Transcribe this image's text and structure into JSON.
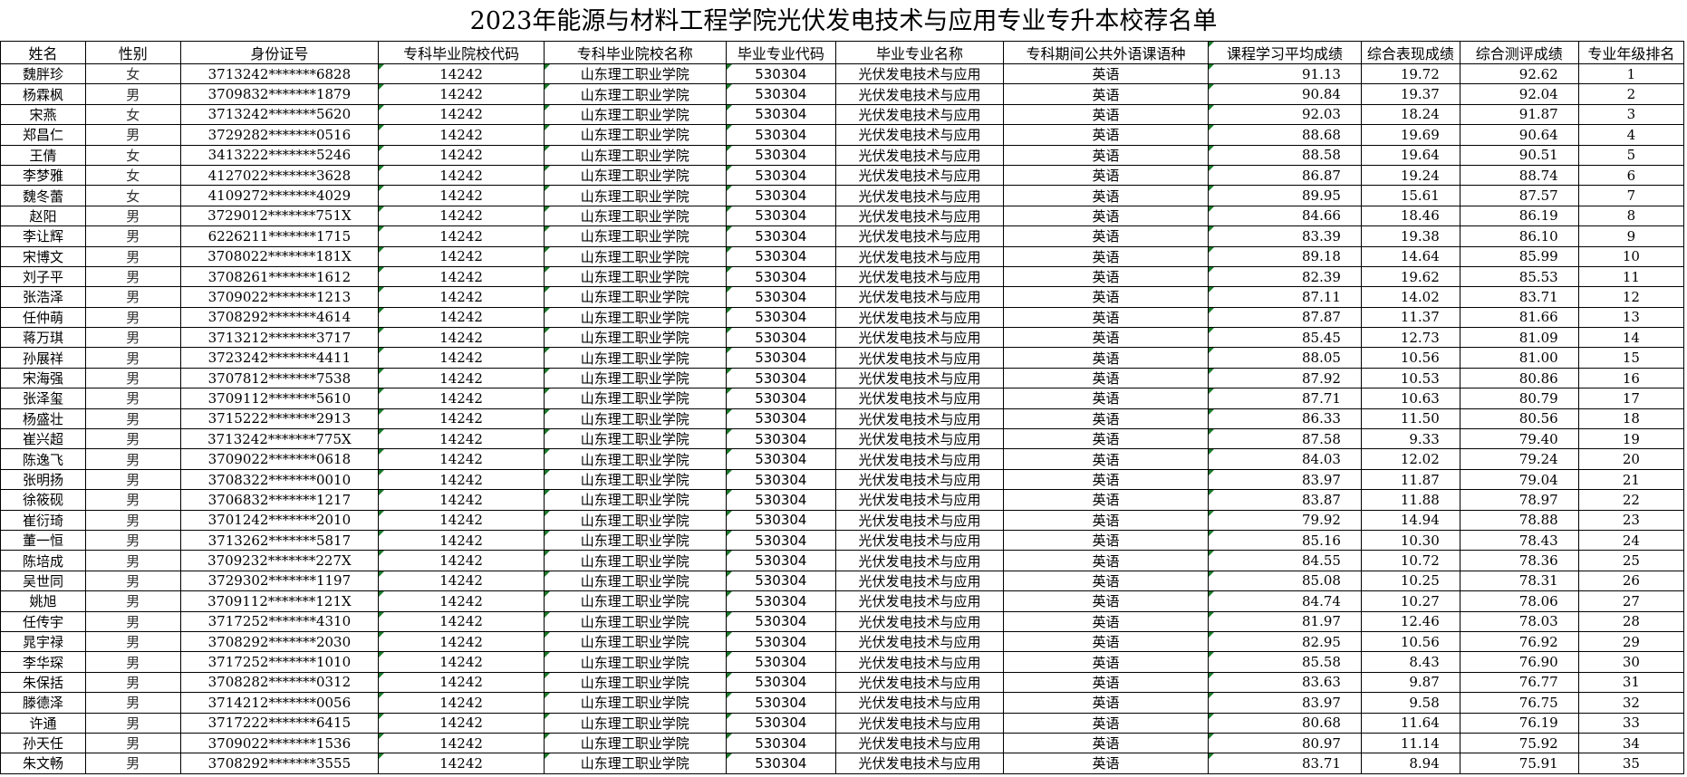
{
  "title": "2023年能源与材料工程学院光伏发电技术与应用专业专升本校荐名单",
  "columns": [
    "姓名",
    "性别",
    "身份证号",
    "专科毕业院校代码",
    "专科毕业院校名称",
    "毕业专业代码",
    "毕业专业名称",
    "专科期间公共外语课语种",
    "课程学习平均成绩",
    "综合表现成绩",
    "综合测评成绩",
    "专业年级排名"
  ],
  "rows": [
    {
      "name": "魏胖珍",
      "gender": "女",
      "id": "3713242*******6828",
      "school_code": "14242",
      "school_name": "山东理工职业学院",
      "major_code": "530304",
      "major_name": "光伏发电技术与应用",
      "language": "英语",
      "avg": "91.13",
      "perf": "19.72",
      "total": "92.62",
      "rank": "1"
    },
    {
      "name": "杨霖枫",
      "gender": "男",
      "id": "3709832*******1879",
      "school_code": "14242",
      "school_name": "山东理工职业学院",
      "major_code": "530304",
      "major_name": "光伏发电技术与应用",
      "language": "英语",
      "avg": "90.84",
      "perf": "19.37",
      "total": "92.04",
      "rank": "2"
    },
    {
      "name": "宋燕",
      "gender": "女",
      "id": "3713242*******5620",
      "school_code": "14242",
      "school_name": "山东理工职业学院",
      "major_code": "530304",
      "major_name": "光伏发电技术与应用",
      "language": "英语",
      "avg": "92.03",
      "perf": "18.24",
      "total": "91.87",
      "rank": "3"
    },
    {
      "name": "郑昌仁",
      "gender": "男",
      "id": "3729282*******0516",
      "school_code": "14242",
      "school_name": "山东理工职业学院",
      "major_code": "530304",
      "major_name": "光伏发电技术与应用",
      "language": "英语",
      "avg": "88.68",
      "perf": "19.69",
      "total": "90.64",
      "rank": "4"
    },
    {
      "name": "王倩",
      "gender": "女",
      "id": "3413222*******5246",
      "school_code": "14242",
      "school_name": "山东理工职业学院",
      "major_code": "530304",
      "major_name": "光伏发电技术与应用",
      "language": "英语",
      "avg": "88.58",
      "perf": "19.64",
      "total": "90.51",
      "rank": "5"
    },
    {
      "name": "李梦雅",
      "gender": "女",
      "id": "4127022*******3628",
      "school_code": "14242",
      "school_name": "山东理工职业学院",
      "major_code": "530304",
      "major_name": "光伏发电技术与应用",
      "language": "英语",
      "avg": "86.87",
      "perf": "19.24",
      "total": "88.74",
      "rank": "6"
    },
    {
      "name": "魏冬蕾",
      "gender": "女",
      "id": "4109272*******4029",
      "school_code": "14242",
      "school_name": "山东理工职业学院",
      "major_code": "530304",
      "major_name": "光伏发电技术与应用",
      "language": "英语",
      "avg": "89.95",
      "perf": "15.61",
      "total": "87.57",
      "rank": "7"
    },
    {
      "name": "赵阳",
      "gender": "男",
      "id": "3729012*******751X",
      "school_code": "14242",
      "school_name": "山东理工职业学院",
      "major_code": "530304",
      "major_name": "光伏发电技术与应用",
      "language": "英语",
      "avg": "84.66",
      "perf": "18.46",
      "total": "86.19",
      "rank": "8"
    },
    {
      "name": "李让辉",
      "gender": "男",
      "id": "6226211*******1715",
      "school_code": "14242",
      "school_name": "山东理工职业学院",
      "major_code": "530304",
      "major_name": "光伏发电技术与应用",
      "language": "英语",
      "avg": "83.39",
      "perf": "19.38",
      "total": "86.10",
      "rank": "9"
    },
    {
      "name": "宋博文",
      "gender": "男",
      "id": "3708022*******181X",
      "school_code": "14242",
      "school_name": "山东理工职业学院",
      "major_code": "530304",
      "major_name": "光伏发电技术与应用",
      "language": "英语",
      "avg": "89.18",
      "perf": "14.64",
      "total": "85.99",
      "rank": "10"
    },
    {
      "name": "刘子平",
      "gender": "男",
      "id": "3708261*******1612",
      "school_code": "14242",
      "school_name": "山东理工职业学院",
      "major_code": "530304",
      "major_name": "光伏发电技术与应用",
      "language": "英语",
      "avg": "82.39",
      "perf": "19.62",
      "total": "85.53",
      "rank": "11"
    },
    {
      "name": "张浩泽",
      "gender": "男",
      "id": "3709022*******1213",
      "school_code": "14242",
      "school_name": "山东理工职业学院",
      "major_code": "530304",
      "major_name": "光伏发电技术与应用",
      "language": "英语",
      "avg": "87.11",
      "perf": "14.02",
      "total": "83.71",
      "rank": "12"
    },
    {
      "name": "任仲萌",
      "gender": "男",
      "id": "3708292*******4614",
      "school_code": "14242",
      "school_name": "山东理工职业学院",
      "major_code": "530304",
      "major_name": "光伏发电技术与应用",
      "language": "英语",
      "avg": "87.87",
      "perf": "11.37",
      "total": "81.66",
      "rank": "13"
    },
    {
      "name": "蒋万琪",
      "gender": "男",
      "id": "3713212*******3717",
      "school_code": "14242",
      "school_name": "山东理工职业学院",
      "major_code": "530304",
      "major_name": "光伏发电技术与应用",
      "language": "英语",
      "avg": "85.45",
      "perf": "12.73",
      "total": "81.09",
      "rank": "14"
    },
    {
      "name": "孙展祥",
      "gender": "男",
      "id": "3723242*******4411",
      "school_code": "14242",
      "school_name": "山东理工职业学院",
      "major_code": "530304",
      "major_name": "光伏发电技术与应用",
      "language": "英语",
      "avg": "88.05",
      "perf": "10.56",
      "total": "81.00",
      "rank": "15"
    },
    {
      "name": "宋海强",
      "gender": "男",
      "id": "3707812*******7538",
      "school_code": "14242",
      "school_name": "山东理工职业学院",
      "major_code": "530304",
      "major_name": "光伏发电技术与应用",
      "language": "英语",
      "avg": "87.92",
      "perf": "10.53",
      "total": "80.86",
      "rank": "16"
    },
    {
      "name": "张泽玺",
      "gender": "男",
      "id": "3709112*******5610",
      "school_code": "14242",
      "school_name": "山东理工职业学院",
      "major_code": "530304",
      "major_name": "光伏发电技术与应用",
      "language": "英语",
      "avg": "87.71",
      "perf": "10.63",
      "total": "80.79",
      "rank": "17"
    },
    {
      "name": "杨盛壮",
      "gender": "男",
      "id": "3715222*******2913",
      "school_code": "14242",
      "school_name": "山东理工职业学院",
      "major_code": "530304",
      "major_name": "光伏发电技术与应用",
      "language": "英语",
      "avg": "86.33",
      "perf": "11.50",
      "total": "80.56",
      "rank": "18"
    },
    {
      "name": "崔兴超",
      "gender": "男",
      "id": "3713242*******775X",
      "school_code": "14242",
      "school_name": "山东理工职业学院",
      "major_code": "530304",
      "major_name": "光伏发电技术与应用",
      "language": "英语",
      "avg": "87.58",
      "perf": "9.33",
      "total": "79.40",
      "rank": "19"
    },
    {
      "name": "陈逸飞",
      "gender": "男",
      "id": "3709022*******0618",
      "school_code": "14242",
      "school_name": "山东理工职业学院",
      "major_code": "530304",
      "major_name": "光伏发电技术与应用",
      "language": "英语",
      "avg": "84.03",
      "perf": "12.02",
      "total": "79.24",
      "rank": "20"
    },
    {
      "name": "张明扬",
      "gender": "男",
      "id": "3708322*******0010",
      "school_code": "14242",
      "school_name": "山东理工职业学院",
      "major_code": "530304",
      "major_name": "光伏发电技术与应用",
      "language": "英语",
      "avg": "83.97",
      "perf": "11.87",
      "total": "79.04",
      "rank": "21"
    },
    {
      "name": "徐筱砚",
      "gender": "男",
      "id": "3706832*******1217",
      "school_code": "14242",
      "school_name": "山东理工职业学院",
      "major_code": "530304",
      "major_name": "光伏发电技术与应用",
      "language": "英语",
      "avg": "83.87",
      "perf": "11.88",
      "total": "78.97",
      "rank": "22"
    },
    {
      "name": "崔衍琦",
      "gender": "男",
      "id": "3701242*******2010",
      "school_code": "14242",
      "school_name": "山东理工职业学院",
      "major_code": "530304",
      "major_name": "光伏发电技术与应用",
      "language": "英语",
      "avg": "79.92",
      "perf": "14.94",
      "total": "78.88",
      "rank": "23"
    },
    {
      "name": "董一恒",
      "gender": "男",
      "id": "3713262*******5817",
      "school_code": "14242",
      "school_name": "山东理工职业学院",
      "major_code": "530304",
      "major_name": "光伏发电技术与应用",
      "language": "英语",
      "avg": "85.16",
      "perf": "10.30",
      "total": "78.43",
      "rank": "24"
    },
    {
      "name": "陈培成",
      "gender": "男",
      "id": "3709232*******227X",
      "school_code": "14242",
      "school_name": "山东理工职业学院",
      "major_code": "530304",
      "major_name": "光伏发电技术与应用",
      "language": "英语",
      "avg": "84.55",
      "perf": "10.72",
      "total": "78.36",
      "rank": "25"
    },
    {
      "name": "吴世同",
      "gender": "男",
      "id": "3729302*******1197",
      "school_code": "14242",
      "school_name": "山东理工职业学院",
      "major_code": "530304",
      "major_name": "光伏发电技术与应用",
      "language": "英语",
      "avg": "85.08",
      "perf": "10.25",
      "total": "78.31",
      "rank": "26"
    },
    {
      "name": "姚旭",
      "gender": "男",
      "id": "3709112*******121X",
      "school_code": "14242",
      "school_name": "山东理工职业学院",
      "major_code": "530304",
      "major_name": "光伏发电技术与应用",
      "language": "英语",
      "avg": "84.74",
      "perf": "10.27",
      "total": "78.06",
      "rank": "27"
    },
    {
      "name": "任传宇",
      "gender": "男",
      "id": "3717252*******4310",
      "school_code": "14242",
      "school_name": "山东理工职业学院",
      "major_code": "530304",
      "major_name": "光伏发电技术与应用",
      "language": "英语",
      "avg": "81.97",
      "perf": "12.46",
      "total": "78.03",
      "rank": "28"
    },
    {
      "name": "晁宇禄",
      "gender": "男",
      "id": "3708292*******2030",
      "school_code": "14242",
      "school_name": "山东理工职业学院",
      "major_code": "530304",
      "major_name": "光伏发电技术与应用",
      "language": "英语",
      "avg": "82.95",
      "perf": "10.56",
      "total": "76.92",
      "rank": "29"
    },
    {
      "name": "李华琛",
      "gender": "男",
      "id": "3717252*******1010",
      "school_code": "14242",
      "school_name": "山东理工职业学院",
      "major_code": "530304",
      "major_name": "光伏发电技术与应用",
      "language": "英语",
      "avg": "85.58",
      "perf": "8.43",
      "total": "76.90",
      "rank": "30"
    },
    {
      "name": "朱保括",
      "gender": "男",
      "id": "3708282*******0312",
      "school_code": "14242",
      "school_name": "山东理工职业学院",
      "major_code": "530304",
      "major_name": "光伏发电技术与应用",
      "language": "英语",
      "avg": "83.63",
      "perf": "9.87",
      "total": "76.77",
      "rank": "31"
    },
    {
      "name": "滕德泽",
      "gender": "男",
      "id": "3714212*******0056",
      "school_code": "14242",
      "school_name": "山东理工职业学院",
      "major_code": "530304",
      "major_name": "光伏发电技术与应用",
      "language": "英语",
      "avg": "83.97",
      "perf": "9.58",
      "total": "76.75",
      "rank": "32"
    },
    {
      "name": "许通",
      "gender": "男",
      "id": "3717222*******6415",
      "school_code": "14242",
      "school_name": "山东理工职业学院",
      "major_code": "530304",
      "major_name": "光伏发电技术与应用",
      "language": "英语",
      "avg": "80.68",
      "perf": "11.64",
      "total": "76.19",
      "rank": "33"
    },
    {
      "name": "孙天任",
      "gender": "男",
      "id": "3709022*******1536",
      "school_code": "14242",
      "school_name": "山东理工职业学院",
      "major_code": "530304",
      "major_name": "光伏发电技术与应用",
      "language": "英语",
      "avg": "80.97",
      "perf": "11.14",
      "total": "75.92",
      "rank": "34"
    },
    {
      "name": "朱文畅",
      "gender": "男",
      "id": "3708292*******3555",
      "school_code": "14242",
      "school_name": "山东理工职业学院",
      "major_code": "530304",
      "major_name": "光伏发电技术与应用",
      "language": "英语",
      "avg": "83.71",
      "perf": "8.94",
      "total": "75.91",
      "rank": "35"
    }
  ]
}
